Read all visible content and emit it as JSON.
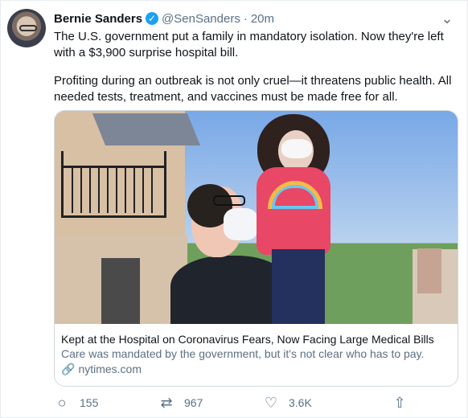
{
  "tweet": {
    "author_name": "Bernie Sanders",
    "handle": "@SenSanders",
    "separator": "·",
    "time": "20m",
    "text_line_1": "The U.S. government put a family in mandatory isolation. Now they're left",
    "text_line_2": "with a $3,900 surprise hospital bill.",
    "text_paragraph_2": "Profiting during an outbreak is not only cruel—it threatens public health. All needed tests, treatment, and vaccines must be made free for all."
  },
  "card": {
    "title": "Kept at the Hospital on Coronavirus Fears, Now Facing Large Medical Bills",
    "description": "Care was mandated by the government, but it's not clear who has to pay.",
    "domain": "nytimes.com"
  },
  "actions": {
    "replies": "155",
    "retweets": "967",
    "likes": "3.6K"
  },
  "icons": {
    "verified": "verified-badge-icon",
    "more": "chevron-down-icon",
    "link": "link-icon",
    "reply": "reply-icon",
    "retweet": "retweet-icon",
    "like": "heart-icon",
    "share": "share-icon"
  },
  "colors": {
    "verified": "#1da1f2",
    "secondary_text": "#5b7083",
    "border": "#cfd9de"
  }
}
